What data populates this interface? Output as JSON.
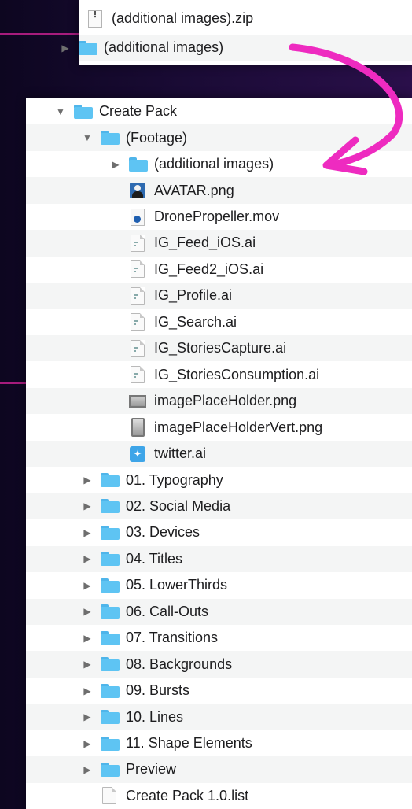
{
  "top_panel": {
    "rows": [
      {
        "name": "(additional images).zip",
        "icon": "zip-file-icon"
      },
      {
        "name": "(additional images)",
        "icon": "folder-icon",
        "disclosure": "collapsed"
      }
    ]
  },
  "main_panel": {
    "rows": [
      {
        "name": "Create Pack",
        "icon": "folder-icon",
        "disclosure": "expanded",
        "level": 0
      },
      {
        "name": "(Footage)",
        "icon": "folder-icon",
        "disclosure": "expanded",
        "level": 1
      },
      {
        "name": "(additional images)",
        "icon": "folder-icon",
        "disclosure": "collapsed",
        "level": 2
      },
      {
        "name": "AVATAR.png",
        "icon": "avatar-image-icon",
        "level": 2
      },
      {
        "name": "DronePropeller.mov",
        "icon": "quicktime-movie-icon",
        "level": 2
      },
      {
        "name": "IG_Feed_iOS.ai",
        "icon": "ai-document-icon",
        "level": 2
      },
      {
        "name": "IG_Feed2_iOS.ai",
        "icon": "ai-document-icon",
        "level": 2
      },
      {
        "name": "IG_Profile.ai",
        "icon": "ai-document-icon",
        "level": 2
      },
      {
        "name": "IG_Search.ai",
        "icon": "ai-document-icon",
        "level": 2
      },
      {
        "name": "IG_StoriesCapture.ai",
        "icon": "ai-document-icon",
        "level": 2
      },
      {
        "name": "IG_StoriesConsumption.ai",
        "icon": "ai-document-icon",
        "level": 2
      },
      {
        "name": "imagePlaceHolder.png",
        "icon": "image-file-icon",
        "level": 2
      },
      {
        "name": "imagePlaceHolderVert.png",
        "icon": "vertical-image-file-icon",
        "level": 2
      },
      {
        "name": "twitter.ai",
        "icon": "twitter-bird-icon",
        "level": 2
      },
      {
        "name": "01. Typography",
        "icon": "folder-icon",
        "disclosure": "collapsed",
        "level": 1
      },
      {
        "name": "02. Social Media",
        "icon": "folder-icon",
        "disclosure": "collapsed",
        "level": 1
      },
      {
        "name": "03. Devices",
        "icon": "folder-icon",
        "disclosure": "collapsed",
        "level": 1
      },
      {
        "name": "04. Titles",
        "icon": "folder-icon",
        "disclosure": "collapsed",
        "level": 1
      },
      {
        "name": "05. LowerThirds",
        "icon": "folder-icon",
        "disclosure": "collapsed",
        "level": 1
      },
      {
        "name": "06. Call-Outs",
        "icon": "folder-icon",
        "disclosure": "collapsed",
        "level": 1
      },
      {
        "name": "07. Transitions",
        "icon": "folder-icon",
        "disclosure": "collapsed",
        "level": 1
      },
      {
        "name": "08. Backgrounds",
        "icon": "folder-icon",
        "disclosure": "collapsed",
        "level": 1
      },
      {
        "name": "09. Bursts",
        "icon": "folder-icon",
        "disclosure": "collapsed",
        "level": 1
      },
      {
        "name": "10. Lines",
        "icon": "folder-icon",
        "disclosure": "collapsed",
        "level": 1
      },
      {
        "name": "11. Shape Elements",
        "icon": "folder-icon",
        "disclosure": "collapsed",
        "level": 1
      },
      {
        "name": "Preview",
        "icon": "folder-icon",
        "disclosure": "collapsed",
        "level": 1
      },
      {
        "name": "Create Pack 1.0.list",
        "icon": "document-icon",
        "level": 1
      }
    ]
  },
  "colors": {
    "accent_arrow": "#ee2bc0",
    "folder_blue": "#5ec4f3",
    "stripe": "#c2208d"
  }
}
